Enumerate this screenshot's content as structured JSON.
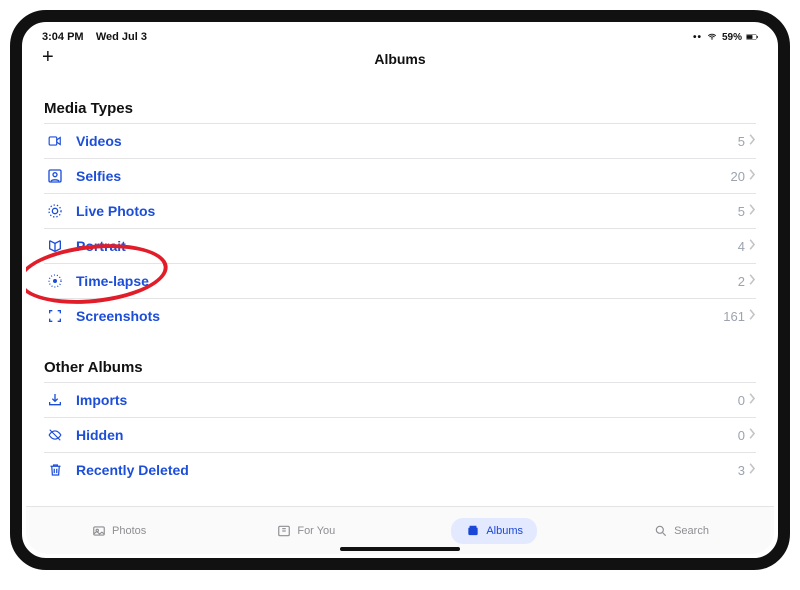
{
  "status_bar": {
    "time": "3:04 PM",
    "date": "Wed Jul 3",
    "battery_text": "59%"
  },
  "nav": {
    "title": "Albums",
    "add_glyph": "+"
  },
  "sections": {
    "media_types": {
      "header": "Media Types",
      "rows": {
        "videos": {
          "label": "Videos",
          "count": "5"
        },
        "selfies": {
          "label": "Selfies",
          "count": "20"
        },
        "live_photos": {
          "label": "Live Photos",
          "count": "5"
        },
        "portrait": {
          "label": "Portrait",
          "count": "4"
        },
        "time_lapse": {
          "label": "Time-lapse",
          "count": "2"
        },
        "screenshots": {
          "label": "Screenshots",
          "count": "161"
        }
      }
    },
    "other_albums": {
      "header": "Other Albums",
      "rows": {
        "imports": {
          "label": "Imports",
          "count": "0"
        },
        "hidden": {
          "label": "Hidden",
          "count": "0"
        },
        "recently_deleted": {
          "label": "Recently Deleted",
          "count": "3"
        }
      }
    }
  },
  "tabbar": {
    "photos": {
      "label": "Photos"
    },
    "for_you": {
      "label": "For You"
    },
    "albums": {
      "label": "Albums"
    },
    "search": {
      "label": "Search"
    }
  },
  "annotation": {
    "target": "time_lapse"
  }
}
